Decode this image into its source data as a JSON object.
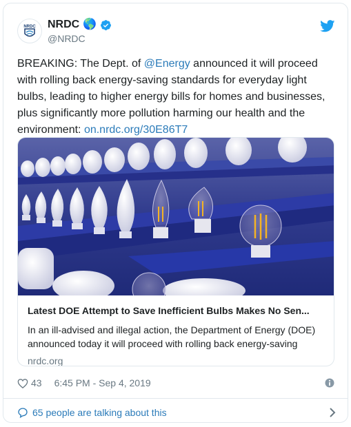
{
  "tweet": {
    "author": {
      "name": "NRDC",
      "handle": "@NRDC",
      "globe_emoji": "🌎",
      "verified": true,
      "avatar_icon": "nrdc-logo-icon"
    },
    "text_parts": [
      {
        "text": "BREAKING: The Dept. of ",
        "link": false
      },
      {
        "text": "@Energy",
        "link": true
      },
      {
        "text": " announced it will proceed with rolling back energy-saving standards for everyday light bulbs, leading to higher energy bills for homes and businesses, plus significantly more pollution harming our health and the environment: ",
        "link": false
      },
      {
        "text": "on.nrdc.org/30E86T7",
        "link": true
      }
    ],
    "link_card": {
      "title": "Latest DOE Attempt to Save Inefficient Bulbs Makes No Sen...",
      "description": "In an ill-advised and illegal action, the Department of Energy (DOE) announced today it will proceed with rolling back energy-saving",
      "domain": "nrdc.org"
    },
    "likes": "43",
    "timestamp": "6:45 PM - Sep 4, 2019",
    "talking": "65 people are talking about this"
  },
  "colors": {
    "link": "#2b7bb9",
    "muted": "#697882",
    "twitter_blue": "#1da1f2",
    "border": "#e1e8ed"
  },
  "icons": [
    "nrdc-logo-icon",
    "globe-icon",
    "verified-badge-icon",
    "twitter-bird-icon",
    "heart-icon",
    "info-icon",
    "speech-bubble-icon",
    "chevron-right-icon"
  ]
}
